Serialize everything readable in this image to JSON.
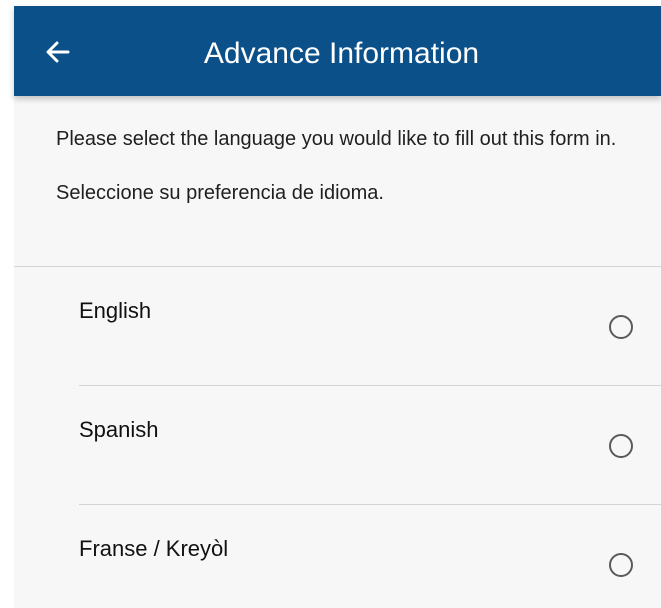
{
  "header": {
    "title": "Advance Information",
    "back_icon": "arrow-left-icon",
    "background_color": "#0b5089"
  },
  "intro": {
    "english_text": "Please select the language you would like to fill out this form in.",
    "spanish_text": "Seleccione su preferencia de idioma."
  },
  "languages": [
    {
      "label": "English",
      "selected": false
    },
    {
      "label": "Spanish",
      "selected": false
    },
    {
      "label": "Franse / Kreyòl",
      "selected": false
    }
  ]
}
